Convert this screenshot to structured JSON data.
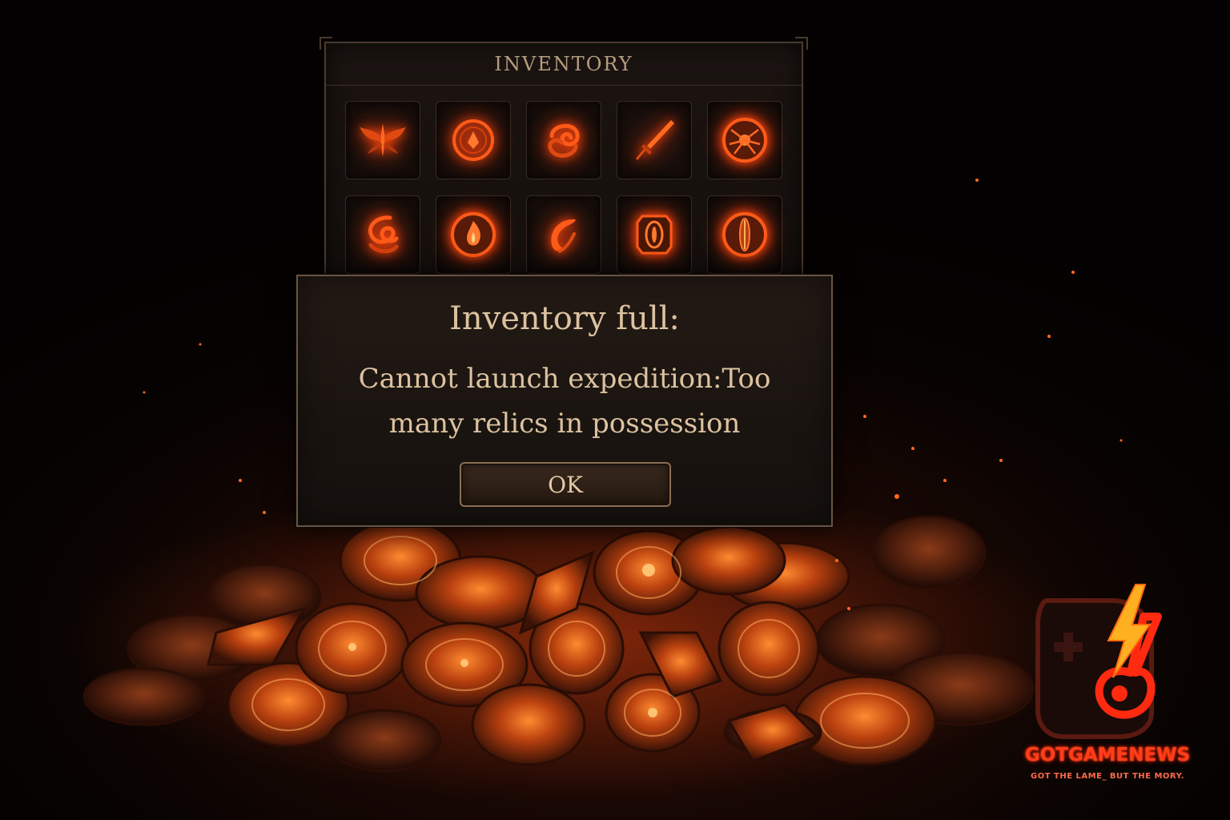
{
  "inventory": {
    "title": "INVENTORY",
    "slots": [
      {
        "icon": "winged-sigil-icon"
      },
      {
        "icon": "round-emblem-icon"
      },
      {
        "icon": "swirl-rune-icon"
      },
      {
        "icon": "blade-icon"
      },
      {
        "icon": "spider-seal-icon"
      },
      {
        "icon": "serpent-coil-icon"
      },
      {
        "icon": "flame-shield-icon"
      },
      {
        "icon": "crescent-wave-icon"
      },
      {
        "icon": "eye-tablet-icon"
      },
      {
        "icon": "ember-eye-icon"
      }
    ]
  },
  "dialog": {
    "title": "Inventory full:",
    "message": "Cannot launch expedition:Too many relics in possession",
    "ok_label": "OK"
  },
  "watermark": {
    "brand": "GOTGAMENEWS",
    "tagline": "GOT THE LAME_ BUT THE MORY."
  },
  "colors": {
    "accent_glow": "#ff4a10",
    "dialog_text": "#dcc2a0",
    "frame": "#6a5442"
  }
}
